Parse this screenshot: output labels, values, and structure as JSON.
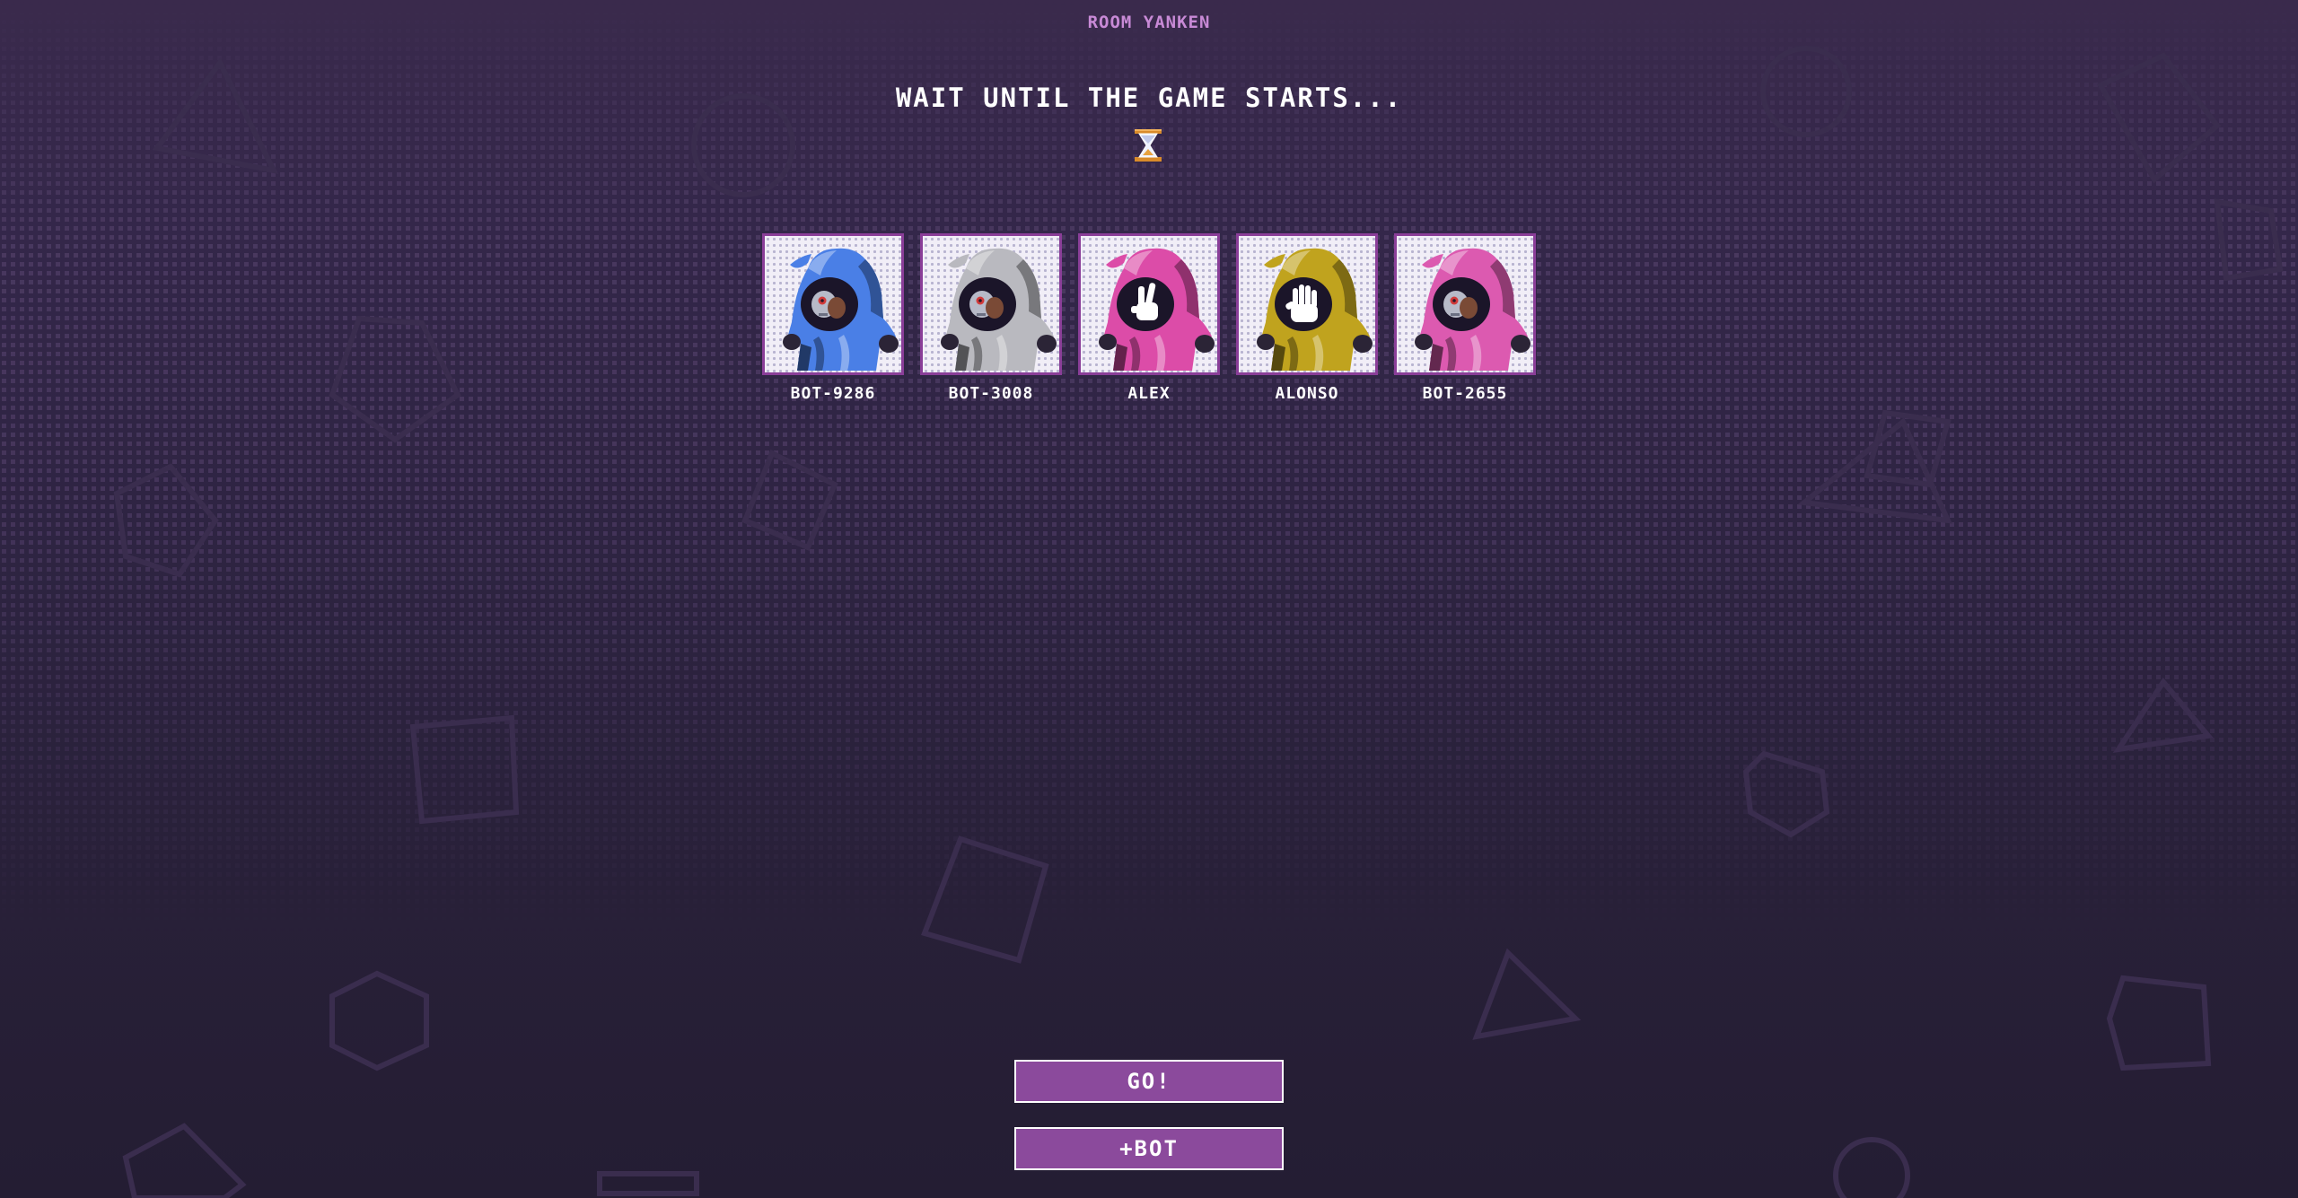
{
  "room": {
    "title": "ROOM YANKEN"
  },
  "status": {
    "message": "WAIT UNTIL THE GAME STARTS..."
  },
  "status_icon": "hourglass-icon",
  "players": [
    {
      "name": "BOT-9286",
      "color": "#4a7fe6",
      "gesture": "none"
    },
    {
      "name": "BOT-3008",
      "color": "#b9b9bf",
      "gesture": "none"
    },
    {
      "name": "ALEX",
      "color": "#dc4ca8",
      "gesture": "scissors"
    },
    {
      "name": "ALONSO",
      "color": "#c0a31e",
      "gesture": "paper"
    },
    {
      "name": "BOT-2655",
      "color": "#dc5ab0",
      "gesture": "none"
    }
  ],
  "buttons": {
    "go_label": "GO!",
    "add_bot_label": "+BOT"
  },
  "colors": {
    "accent": "#8b4a9c",
    "card_border": "#8a3e98",
    "room_title": "#c88ad6",
    "background_top": "#3a2a4c",
    "background_bottom": "#241d33"
  }
}
